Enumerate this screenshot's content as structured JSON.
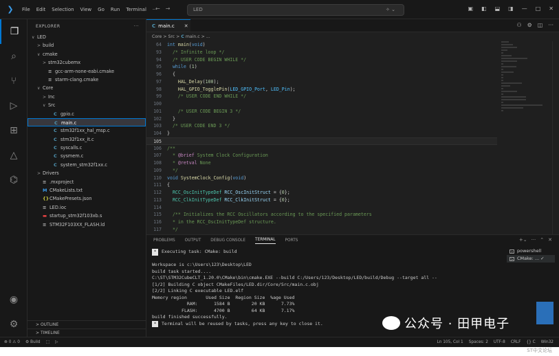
{
  "titlebar": {
    "menu": [
      "File",
      "Edit",
      "Selection",
      "View",
      "Go",
      "Run",
      "Terminal",
      "···"
    ],
    "search": "LED",
    "window_controls": [
      "minimize",
      "maximize",
      "close"
    ]
  },
  "activity_icons": [
    "files-icon",
    "search-icon",
    "source-control-icon",
    "run-debug-icon",
    "extensions-icon",
    "cmake-icon",
    "stm32-icon",
    "account-icon",
    "settings-icon"
  ],
  "sidebar": {
    "title": "EXPLORER",
    "tree": [
      {
        "label": "LED",
        "depth": 0,
        "chev": "∨",
        "icon": "",
        "color": "#c4c4c4"
      },
      {
        "label": "build",
        "depth": 1,
        "chev": ">",
        "icon": "",
        "color": "#c4c4c4"
      },
      {
        "label": "cmake",
        "depth": 1,
        "chev": "∨",
        "icon": "",
        "color": "#c4c4c4"
      },
      {
        "label": "stm32cubemx",
        "depth": 2,
        "chev": ">",
        "icon": "",
        "color": "#c4c4c4"
      },
      {
        "label": "gcc-arm-none-eabi.cmake",
        "depth": 2,
        "chev": "",
        "icon": "≡",
        "color": "#c4c4c4"
      },
      {
        "label": "starm-clang.cmake",
        "depth": 2,
        "chev": "",
        "icon": "≡",
        "color": "#c4c4c4"
      },
      {
        "label": "Core",
        "depth": 1,
        "chev": "∨",
        "icon": "",
        "color": "#c4c4c4"
      },
      {
        "label": "Inc",
        "depth": 2,
        "chev": ">",
        "icon": "",
        "color": "#c4c4c4"
      },
      {
        "label": "Src",
        "depth": 2,
        "chev": "∨",
        "icon": "",
        "color": "#c4c4c4"
      },
      {
        "label": "gpio.c",
        "depth": 3,
        "chev": "",
        "icon": "C",
        "color": "#c4c4c4"
      },
      {
        "label": "main.c",
        "depth": 3,
        "chev": "",
        "icon": "C",
        "color": "#ffffff",
        "selected": true
      },
      {
        "label": "stm32f1xx_hal_msp.c",
        "depth": 3,
        "chev": "",
        "icon": "C",
        "color": "#c4c4c4"
      },
      {
        "label": "stm32f1xx_it.c",
        "depth": 3,
        "chev": "",
        "icon": "C",
        "color": "#c4c4c4"
      },
      {
        "label": "syscalls.c",
        "depth": 3,
        "chev": "",
        "icon": "C",
        "color": "#c4c4c4"
      },
      {
        "label": "sysmem.c",
        "depth": 3,
        "chev": "",
        "icon": "C",
        "color": "#c4c4c4"
      },
      {
        "label": "system_stm32f1xx.c",
        "depth": 3,
        "chev": "",
        "icon": "C",
        "color": "#c4c4c4"
      },
      {
        "label": "Drivers",
        "depth": 1,
        "chev": ">",
        "icon": "",
        "color": "#c4c4c4"
      },
      {
        "label": ".mxproject",
        "depth": 1,
        "chev": "",
        "icon": "≡",
        "color": "#c4c4c4"
      },
      {
        "label": "CMakeLists.txt",
        "depth": 1,
        "chev": "",
        "icon": "M",
        "color": "#c4c4c4"
      },
      {
        "label": "CMakePresets.json",
        "depth": 1,
        "chev": "",
        "icon": "{}",
        "color": "#c4c4c4"
      },
      {
        "label": "LED.ioc",
        "depth": 1,
        "chev": "",
        "icon": "≡",
        "color": "#c4c4c4"
      },
      {
        "label": "startup_stm32f103xb.s",
        "depth": 1,
        "chev": "",
        "icon": "▬",
        "color": "#c4c4c4"
      },
      {
        "label": "STM32F103XX_FLASH.ld",
        "depth": 1,
        "chev": "",
        "icon": "≡",
        "color": "#c4c4c4"
      }
    ],
    "outline": "OUTLINE",
    "timeline": "TIMELINE"
  },
  "editor": {
    "tab_label": "main.c",
    "breadcrumb": [
      "Core",
      "Src",
      "main.c",
      "..."
    ],
    "current_line": "105",
    "lines": [
      {
        "n": "64",
        "t": "int main(void)"
      },
      {
        "n": "93",
        "t": "  /* Infinite loop */"
      },
      {
        "n": "94",
        "t": "  /* USER CODE BEGIN WHILE */"
      },
      {
        "n": "95",
        "t": "  while (1)"
      },
      {
        "n": "96",
        "t": "  {"
      },
      {
        "n": "97",
        "t": "    HAL_Delay(100);"
      },
      {
        "n": "98",
        "t": "    HAL_GPIO_TogglePin(LED_GPIO_Port, LED_Pin);"
      },
      {
        "n": "99",
        "t": "    /* USER CODE END WHILE */"
      },
      {
        "n": "100",
        "t": ""
      },
      {
        "n": "101",
        "t": "    /* USER CODE BEGIN 3 */"
      },
      {
        "n": "102",
        "t": "  }"
      },
      {
        "n": "103",
        "t": "  /* USER CODE END 3 */"
      },
      {
        "n": "104",
        "t": "}"
      },
      {
        "n": "105",
        "t": ""
      },
      {
        "n": "106",
        "t": "/**"
      },
      {
        "n": "107",
        "t": "  * @brief System Clock Configuration"
      },
      {
        "n": "108",
        "t": "  * @retval None"
      },
      {
        "n": "109",
        "t": "  */"
      },
      {
        "n": "110",
        "t": "void SystemClock_Config(void)"
      },
      {
        "n": "111",
        "t": "{"
      },
      {
        "n": "112",
        "t": "  RCC_OscInitTypeDef RCC_OscInitStruct = {0};"
      },
      {
        "n": "113",
        "t": "  RCC_ClkInitTypeDef RCC_ClkInitStruct = {0};"
      },
      {
        "n": "114",
        "t": ""
      },
      {
        "n": "115",
        "t": "  /** Initializes the RCC Oscillators according to the specified parameters"
      },
      {
        "n": "116",
        "t": "  * in the RCC_OscInitTypeDef structure."
      },
      {
        "n": "117",
        "t": "  */"
      }
    ]
  },
  "panel": {
    "tabs": [
      "PROBLEMS",
      "OUTPUT",
      "DEBUG CONSOLE",
      "TERMINAL",
      "PORTS"
    ],
    "active_tab": "TERMINAL",
    "terminal_lines": [
      {
        "star": true,
        "t": "Executing task: CMake: build"
      },
      {
        "star": false,
        "t": ""
      },
      {
        "star": false,
        "t": "Workspace is c:\\Users\\123\\Desktop\\LED"
      },
      {
        "star": false,
        "t": "build task started...."
      },
      {
        "star": false,
        "t": "C:\\ST\\STM32CubeCLT_1.20.0\\CMake\\bin\\cmake.EXE --build C:/Users/123/Desktop/LED/build/Debug --target all --"
      },
      {
        "star": false,
        "t": "[1/2] Building C object CMakeFiles/LED.dir/Core/Src/main.c.obj"
      },
      {
        "star": false,
        "t": "[2/2] Linking C executable LED.elf"
      },
      {
        "star": false,
        "t": "Memory region       Used Size  Region Size  %age Used"
      },
      {
        "star": false,
        "t": "             RAM:      1584 B        20 KB      7.73%"
      },
      {
        "star": false,
        "t": "           FLASH:      4700 B        64 KB      7.17%"
      },
      {
        "star": false,
        "t": "build finished successfully."
      },
      {
        "star": true,
        "t": "Terminal will be reused by tasks, press any key to close it."
      }
    ],
    "terminal_list": [
      "powershell",
      "CMake: ... ✓"
    ]
  },
  "statusbar": {
    "left": [
      "⊗ 0 ⚠ 0",
      "⚙ Build",
      "⬚",
      "▷"
    ],
    "right": [
      "Ln 105, Col 1",
      "Spaces: 2",
      "UTF-8",
      "CRLF",
      "{} C",
      "Win32"
    ]
  },
  "watermark": {
    "text": "公众号 · 田甲电子",
    "corner": "ST中文论坛"
  }
}
